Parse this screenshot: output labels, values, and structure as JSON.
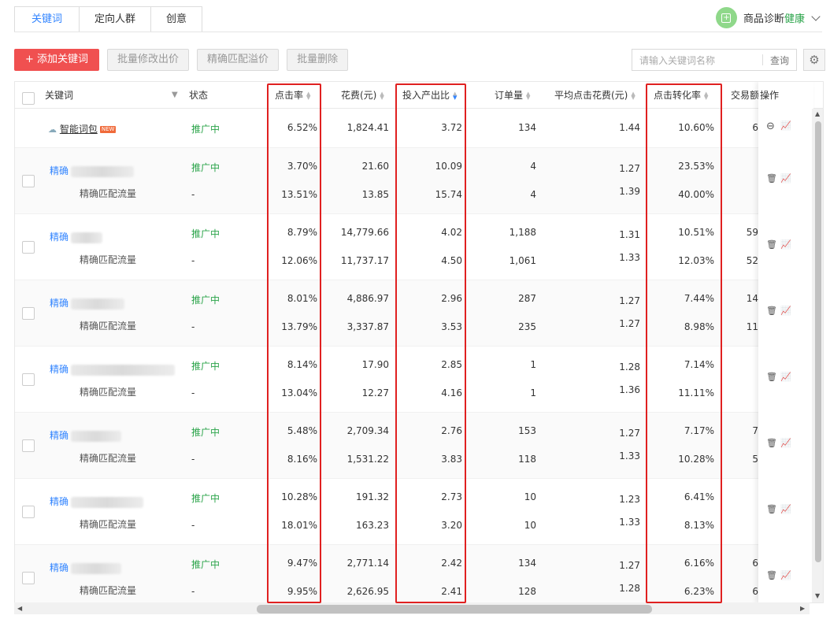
{
  "tabs": [
    "关键词",
    "定向人群",
    "创意"
  ],
  "diagnosis": {
    "label": "商品诊断",
    "status": "健康"
  },
  "toolbar": {
    "add": "+ 添加关键词",
    "batch_price": "批量修改出价",
    "exact_premium": "精确匹配溢价",
    "batch_delete": "批量删除"
  },
  "search": {
    "placeholder": "请输入关键词名称",
    "button": "查询"
  },
  "columns": {
    "keyword": "关键词",
    "status": "状态",
    "ctr": "点击率",
    "cost": "花费(元)",
    "roi": "投入产出比",
    "orders": "订单量",
    "cpc": "平均点击花费(元)",
    "cvr": "点击转化率",
    "gmv": "交易额",
    "ops": "操作"
  },
  "smart": {
    "name": "智能词包",
    "badge": "NEW",
    "status": "推广中",
    "ctr": "6.52%",
    "cost": "1,824.41",
    "roi": "3.72",
    "orders": "134",
    "cpc": "1.44",
    "cvr": "10.60%",
    "gmv": "6"
  },
  "rows": [
    {
      "tag": "精确",
      "status": "推广中",
      "sub": "精确匹配流量",
      "sub_status": "-",
      "ctr": [
        "3.70%",
        "13.51%"
      ],
      "cost": [
        "21.60",
        "13.85"
      ],
      "roi": [
        "10.09",
        "15.74"
      ],
      "orders": [
        "4",
        "4"
      ],
      "cpc": [
        "1.27",
        "1.39"
      ],
      "cvr": [
        "23.53%",
        "40.00%"
      ],
      "gmv": [
        "",
        ""
      ]
    },
    {
      "tag": "精确",
      "status": "推广中",
      "sub": "精确匹配流量",
      "sub_status": "-",
      "ctr": [
        "8.79%",
        "12.06%"
      ],
      "cost": [
        "14,779.66",
        "11,737.17"
      ],
      "roi": [
        "4.02",
        "4.50"
      ],
      "orders": [
        "1,188",
        "1,061"
      ],
      "cpc": [
        "1.31",
        "1.33"
      ],
      "cvr": [
        "10.51%",
        "12.03%"
      ],
      "gmv": [
        "59",
        "52"
      ]
    },
    {
      "tag": "精确",
      "status": "推广中",
      "sub": "精确匹配流量",
      "sub_status": "-",
      "ctr": [
        "8.01%",
        "13.79%"
      ],
      "cost": [
        "4,886.97",
        "3,337.87"
      ],
      "roi": [
        "2.96",
        "3.53"
      ],
      "orders": [
        "287",
        "235"
      ],
      "cpc": [
        "1.27",
        "1.27"
      ],
      "cvr": [
        "7.44%",
        "8.98%"
      ],
      "gmv": [
        "14",
        "11"
      ]
    },
    {
      "tag": "精确",
      "status": "推广中",
      "sub": "精确匹配流量",
      "sub_status": "-",
      "ctr": [
        "8.14%",
        "13.04%"
      ],
      "cost": [
        "17.90",
        "12.27"
      ],
      "roi": [
        "2.85",
        "4.16"
      ],
      "orders": [
        "1",
        "1"
      ],
      "cpc": [
        "1.28",
        "1.36"
      ],
      "cvr": [
        "7.14%",
        "11.11%"
      ],
      "gmv": [
        "",
        ""
      ]
    },
    {
      "tag": "精确",
      "status": "推广中",
      "sub": "精确匹配流量",
      "sub_status": "-",
      "ctr": [
        "5.48%",
        "8.16%"
      ],
      "cost": [
        "2,709.34",
        "1,531.22"
      ],
      "roi": [
        "2.76",
        "3.83"
      ],
      "orders": [
        "153",
        "118"
      ],
      "cpc": [
        "1.27",
        "1.33"
      ],
      "cvr": [
        "7.17%",
        "10.28%"
      ],
      "gmv": [
        "7",
        "5"
      ]
    },
    {
      "tag": "精确",
      "status": "推广中",
      "sub": "精确匹配流量",
      "sub_status": "-",
      "ctr": [
        "10.28%",
        "18.01%"
      ],
      "cost": [
        "191.32",
        "163.23"
      ],
      "roi": [
        "2.73",
        "3.20"
      ],
      "orders": [
        "10",
        "10"
      ],
      "cpc": [
        "1.23",
        "1.33"
      ],
      "cvr": [
        "6.41%",
        "8.13%"
      ],
      "gmv": [
        "",
        ""
      ]
    },
    {
      "tag": "精确",
      "status": "推广中",
      "sub": "精确匹配流量",
      "sub_status": "-",
      "ctr": [
        "9.47%",
        "9.95%"
      ],
      "cost": [
        "2,771.14",
        "2,626.95"
      ],
      "roi": [
        "2.42",
        "2.41"
      ],
      "orders": [
        "134",
        "128"
      ],
      "cpc": [
        "1.27",
        "1.28"
      ],
      "cvr": [
        "6.16%",
        "6.23%"
      ],
      "gmv": [
        "6",
        "6"
      ]
    }
  ],
  "colors": {
    "accent": "#3385ff",
    "danger": "#f05050",
    "success": "#2ba44a",
    "highlight": "#e02020"
  }
}
